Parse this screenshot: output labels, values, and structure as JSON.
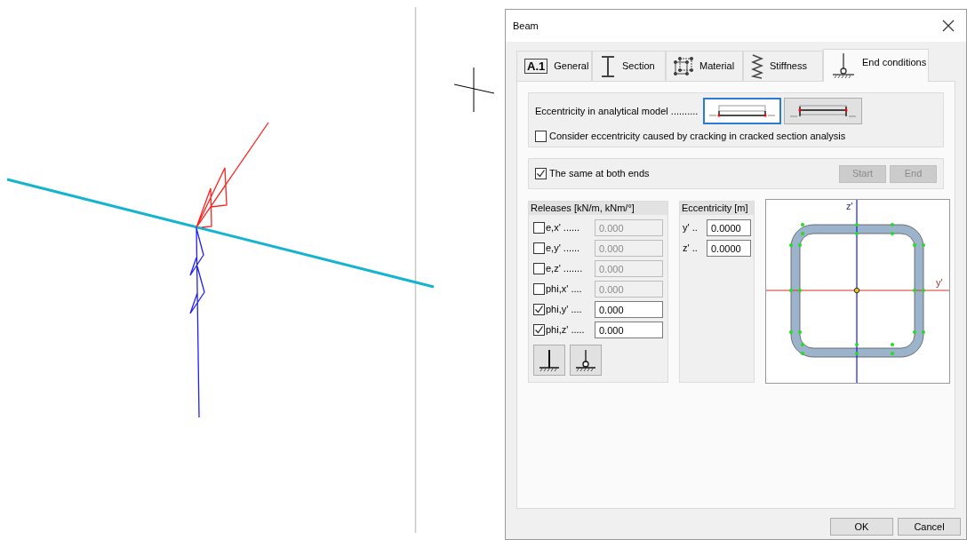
{
  "window": {
    "title": "Beam"
  },
  "tabs": [
    {
      "label": "General",
      "kind": "general",
      "badge": "A.1",
      "selected": false
    },
    {
      "label": "Section",
      "kind": "section",
      "selected": false
    },
    {
      "label": "Material",
      "kind": "material",
      "selected": false
    },
    {
      "label": "Stiffness",
      "kind": "stiffness",
      "selected": false
    },
    {
      "label": "End conditions",
      "kind": "support",
      "selected": true
    }
  ],
  "eccentricity_model": {
    "label": "Eccentricity in analytical model ..........",
    "options": [
      {
        "kind": "bottom",
        "selected": true
      },
      {
        "kind": "axis",
        "selected": false
      }
    ]
  },
  "cracking": {
    "label": "Consider eccentricity caused by cracking in cracked section analysis",
    "checked": false
  },
  "same_both_ends": {
    "label": "The same at both ends",
    "checked": true
  },
  "end_buttons": [
    {
      "label": "Start",
      "disabled": true
    },
    {
      "label": "End",
      "disabled": true
    }
  ],
  "releases": {
    "title": "Releases [kN/m, kNm/°]",
    "rows": [
      {
        "label": "e,x' ......",
        "checked": false,
        "value": "0.000"
      },
      {
        "label": "e,y' ......",
        "checked": false,
        "value": "0.000"
      },
      {
        "label": "e,z' .......",
        "checked": false,
        "value": "0.000"
      },
      {
        "label": "phi,x' ....",
        "checked": false,
        "value": "0.000"
      },
      {
        "label": "phi,y' ....",
        "checked": true,
        "value": "0.000"
      },
      {
        "label": "phi,z' .....",
        "checked": true,
        "value": "0.000"
      }
    ],
    "supports": [
      {
        "kind": "fixed"
      },
      {
        "kind": "pinned"
      }
    ]
  },
  "eccentricity": {
    "title": "Eccentricity [m]",
    "rows": [
      {
        "label": "y' ..",
        "value": "0.0000"
      },
      {
        "label": "z' ..",
        "value": "0.0000"
      }
    ]
  },
  "section_preview": {
    "z_label": "z'",
    "y_label": "y'"
  },
  "buttons": [
    "OK",
    "Cancel"
  ]
}
